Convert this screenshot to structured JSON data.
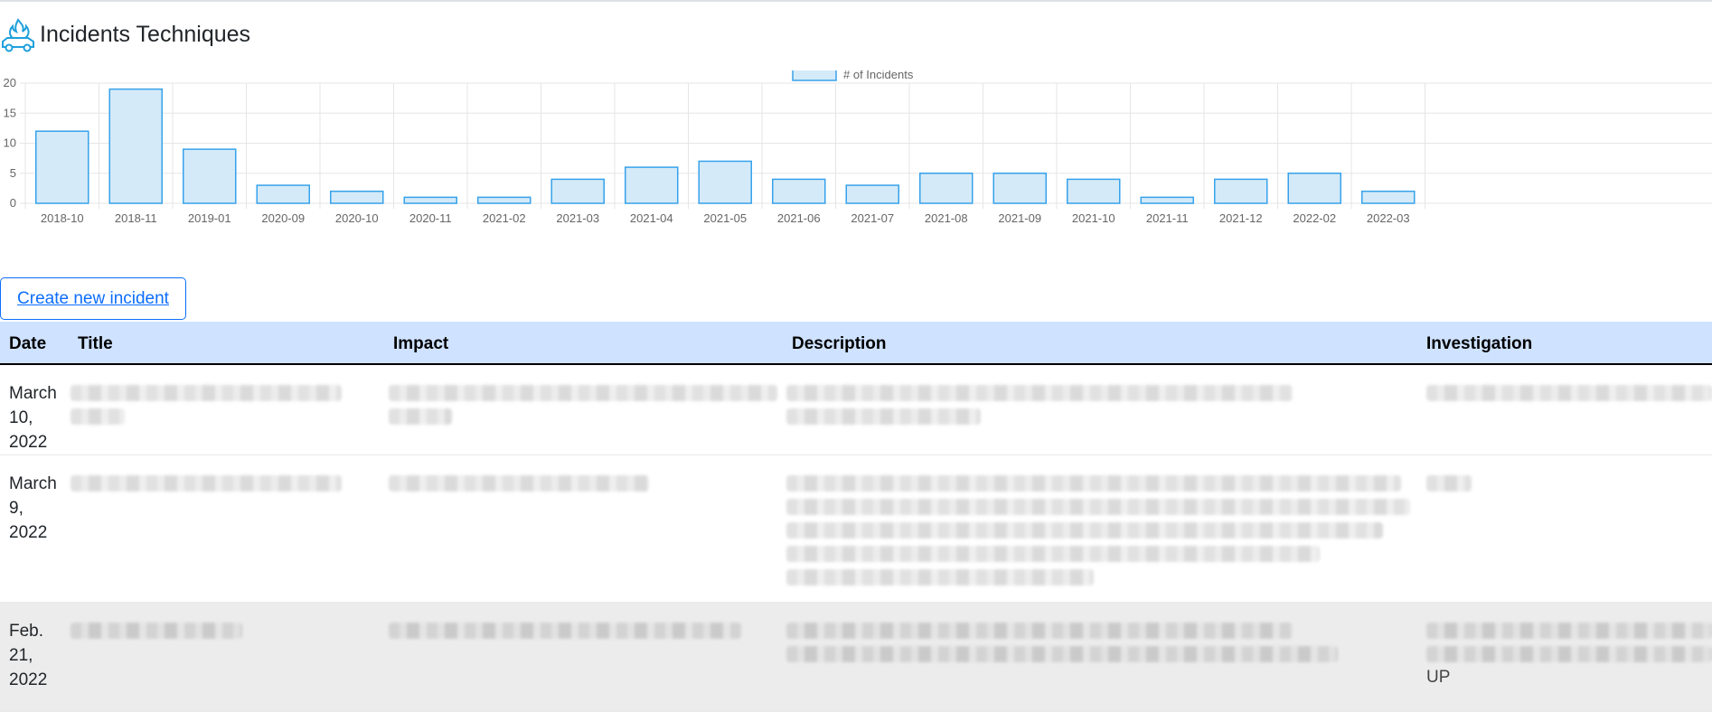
{
  "header": {
    "title": "Incidents Techniques",
    "logo_icon": "car-fire-icon"
  },
  "chart_data": {
    "type": "bar",
    "categories": [
      "2018-10",
      "2018-11",
      "2019-01",
      "2020-09",
      "2020-10",
      "2020-11",
      "2021-02",
      "2021-03",
      "2021-04",
      "2021-05",
      "2021-06",
      "2021-07",
      "2021-08",
      "2021-09",
      "2021-10",
      "2021-11",
      "2021-12",
      "2022-02",
      "2022-03"
    ],
    "series": [
      {
        "name": "# of Incidents",
        "values": [
          12,
          19,
          9,
          3,
          2,
          1,
          1,
          4,
          6,
          7,
          4,
          3,
          5,
          5,
          4,
          1,
          4,
          5,
          2
        ]
      }
    ],
    "ylim": [
      0,
      20
    ],
    "yticks": [
      "0",
      "5",
      "10",
      "15",
      "20"
    ],
    "grid": true,
    "legend": "top-center",
    "colors": {
      "fill": "#d4eaf8",
      "stroke": "#36a2eb",
      "grid": "#e5e5e5"
    }
  },
  "actions": {
    "create_label": "Create new incident"
  },
  "table": {
    "columns": [
      "Date",
      "Title",
      "Impact",
      "Description",
      "Investigation"
    ],
    "rows": [
      {
        "date_lines": [
          "March",
          "10,",
          "2022"
        ]
      },
      {
        "date_lines": [
          "March",
          "9,",
          "2022"
        ]
      },
      {
        "date_lines": [
          "Feb.",
          "21,",
          "2022"
        ]
      }
    ],
    "fragments": {
      "investigation_row3": "UP"
    }
  }
}
